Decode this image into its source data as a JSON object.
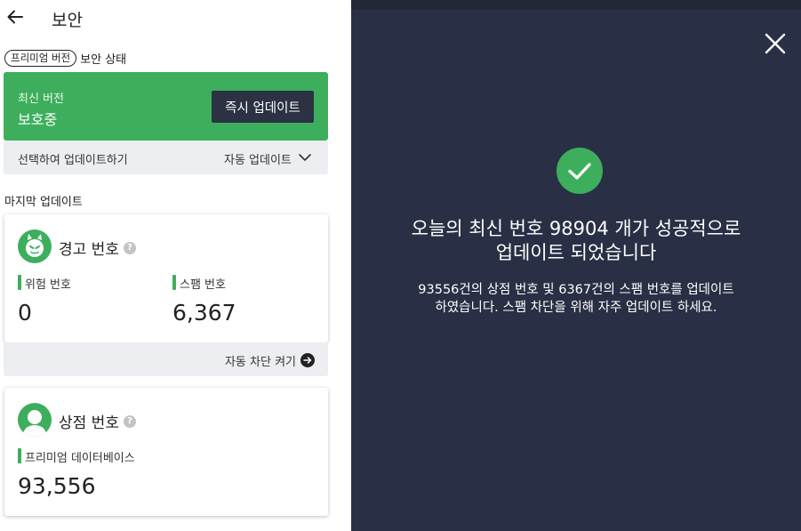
{
  "header": {
    "title": "보안"
  },
  "status": {
    "badge": "프리미엄 버전",
    "label": "보안 상태"
  },
  "protection": {
    "line1": "최신 버전",
    "line2": "보호중",
    "update_button": "즉시 업데이트"
  },
  "update_mode": {
    "left_label": "선택하여 업데이트하기",
    "right_label": "자동 업데이트"
  },
  "last_update_label": "마지막 업데이트",
  "warning_card": {
    "title": "경고 번호",
    "stat1_label": "위험 번호",
    "stat1_value": "0",
    "stat2_label": "스팸 번호",
    "stat2_value": "6,367",
    "footer_action": "자동 차단 켜기"
  },
  "shop_card": {
    "title": "상점 번호",
    "stat_label": "프리미엄 데이터베이스",
    "stat_value": "93,556"
  },
  "overlay": {
    "title_line1": "오늘의 최신 번호 98904 개가 성공적으로",
    "title_line2": "업데이트 되었습니다",
    "desc_line1": "93556건의 상점 번호 및 6367건의 스팸 번호를 업데이트",
    "desc_line2": "하였습니다. 스팸 차단을 위해 자주 업데이트 하세요."
  },
  "icons": {
    "back": "back-arrow-icon",
    "chevron": "chevron-down-icon",
    "devil": "devil-icon",
    "person": "person-icon",
    "help": "help-icon",
    "arrow": "arrow-right-circle-icon",
    "close": "close-icon",
    "check": "check-circle-icon"
  },
  "colors": {
    "accent_green": "#3daf5c",
    "dark_button": "#2a3243",
    "overlay_bg": "#293045",
    "light_bar": "#eceef1"
  }
}
